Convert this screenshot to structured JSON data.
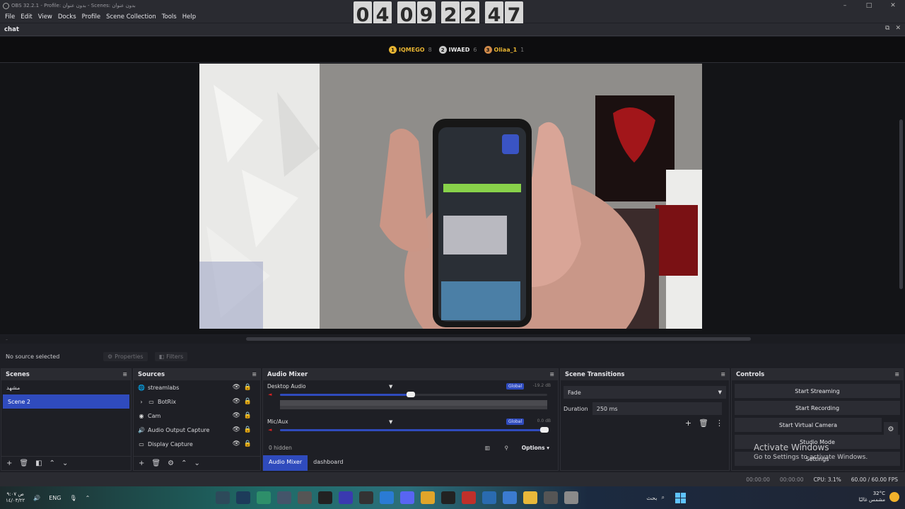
{
  "window": {
    "title": "OBS 32.2.1 - Profile: بدون عنوان - Scenes: بدون عنوان",
    "controls": [
      "–",
      "□",
      "✕"
    ]
  },
  "menu": [
    "File",
    "Edit",
    "View",
    "Docks",
    "Profile",
    "Scene Collection",
    "Tools",
    "Help"
  ],
  "timer": {
    "digits": [
      "0",
      "4",
      "0",
      "9",
      "2",
      "2",
      "4",
      "7"
    ]
  },
  "chat_dock": {
    "label": "chat",
    "leaderboard": [
      {
        "rank": "1",
        "name": "IQMEGO",
        "score": "8",
        "color": "#e7b432"
      },
      {
        "rank": "2",
        "name": "IWAED",
        "score": "6",
        "color": "#c9c9c9"
      },
      {
        "rank": "3",
        "name": "Oliaa_1",
        "score": "1",
        "color": "#d08a4a",
        "nameColor": "#e7b432"
      }
    ]
  },
  "context": {
    "no_source": "No source selected",
    "properties": "Properties",
    "filters": "Filters"
  },
  "scenes": {
    "header": "Scenes",
    "items": [
      {
        "label": "مشهد",
        "selected": false
      },
      {
        "label": "Scene 2",
        "selected": true
      }
    ]
  },
  "sources": {
    "header": "Sources",
    "items": [
      {
        "label": "streamlabs",
        "icon": "globe-icon"
      },
      {
        "label": "BotRix",
        "icon": "folder-icon"
      },
      {
        "label": "Cam",
        "icon": "camera-icon"
      },
      {
        "label": "Audio Output Capture",
        "icon": "speaker-icon"
      },
      {
        "label": "Display Capture",
        "icon": "monitor-icon"
      }
    ]
  },
  "mixer": {
    "header": "Audio Mixer",
    "channels": [
      {
        "name": "Desktop Audio",
        "badge": "Global",
        "db": "-19.2 dB",
        "level": 0.5
      },
      {
        "name": "Mic/Aux",
        "badge": "Global",
        "db": "0.0 dB",
        "level": 1.0
      }
    ],
    "hidden": "0 hidden",
    "options": "Options",
    "tabs": [
      "Audio Mixer",
      "dashboard"
    ]
  },
  "transitions": {
    "header": "Scene Transitions",
    "selected": "Fade",
    "duration_label": "Duration",
    "duration_value": "250 ms"
  },
  "controls": {
    "header": "Controls",
    "buttons": [
      "Start Streaming",
      "Start Recording",
      "Start Virtual Camera",
      "Studio Mode",
      "Settings"
    ]
  },
  "watermark": {
    "line1": "Activate Windows",
    "line2": "Go to Settings to activate Windows."
  },
  "status": {
    "time1": "00:00:00",
    "time2": "00:00:00",
    "cpu": "CPU: 3.1%",
    "fps": "60.00 / 60.00 FPS"
  },
  "taskbar": {
    "clock_time": "ص ٩:٠٧",
    "clock_date": "١٤/٠٣/٢٢",
    "lang": "ENG",
    "search": "بحث",
    "weather_temp": "32°C",
    "weather_desc": "مشمس غالبًا"
  },
  "colors": {
    "accent": "#2f4bbd",
    "bg": "#1e1f25"
  }
}
